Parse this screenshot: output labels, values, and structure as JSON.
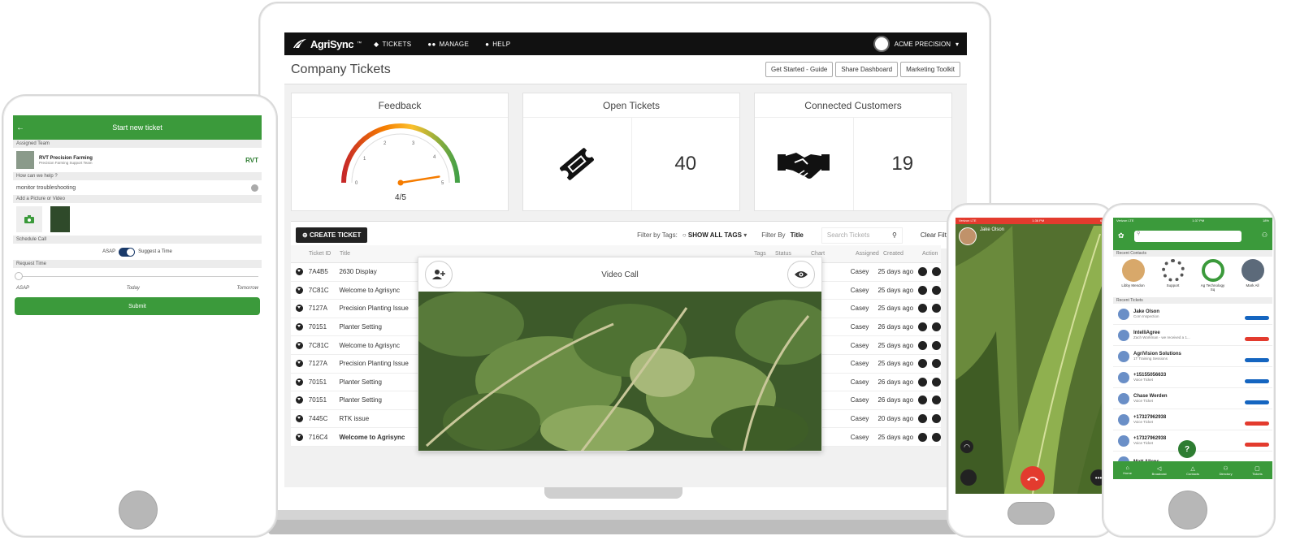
{
  "colors": {
    "green": "#3b9a3b",
    "dark": "#111111",
    "red": "#e33b2e",
    "blue": "#1565c0"
  },
  "laptop": {
    "nav": {
      "brand": "AgriSync",
      "brand_tm": "™",
      "tickets": "TICKETS",
      "manage": "MANAGE",
      "help": "HELP",
      "account": "ACME PRECISION"
    },
    "page_title": "Company Tickets",
    "header_buttons": [
      "Get Started - Guide",
      "Share Dashboard",
      "Marketing Toolkit"
    ],
    "cards": {
      "feedback": {
        "title": "Feedback",
        "value": "4/5",
        "score": 4,
        "max": 5,
        "ticks": [
          "0",
          "1",
          "2",
          "3",
          "4",
          "5"
        ]
      },
      "open": {
        "title": "Open Tickets",
        "value": "40"
      },
      "connected": {
        "title": "Connected Customers",
        "value": "19"
      }
    },
    "toolbar": {
      "create": "CREATE TICKET",
      "filter_tags_label": "Filter by Tags:",
      "show_all": "SHOW ALL TAGS",
      "filter_by_label": "Filter By",
      "filter_by_value": "Title",
      "search_placeholder": "Search Tickets",
      "clear": "Clear Filters"
    },
    "table": {
      "headers": {
        "id": "Ticket ID",
        "title": "Title",
        "tags": "Tags",
        "status": "Status",
        "chart": "Chart",
        "assigned": "Assigned",
        "created": "Created",
        "action": "Action"
      },
      "rows": [
        {
          "id": "7A4B5",
          "title": "2630 Display",
          "assigned": "Casey",
          "created": "25 days ago"
        },
        {
          "id": "7C81C",
          "title": "Welcome to Agrisync",
          "assigned": "Casey",
          "created": "25 days ago"
        },
        {
          "id": "7127A",
          "title": "Precision Planting Issue",
          "assigned": "Casey",
          "created": "25 days ago"
        },
        {
          "id": "70151",
          "title": "Planter Setting",
          "assigned": "Casey",
          "created": "26 days ago"
        },
        {
          "id": "7C81C",
          "title": "Welcome to Agrisync",
          "assigned": "Casey",
          "created": "25 days ago"
        },
        {
          "id": "7127A",
          "title": "Precision Planting Issue",
          "assigned": "Casey",
          "created": "25 days ago"
        },
        {
          "id": "70151",
          "title": "Planter Setting",
          "assigned": "Casey",
          "created": "26 days ago"
        },
        {
          "id": "70151",
          "title": "Planter Setting",
          "assigned": "Casey",
          "created": "26 days ago"
        },
        {
          "id": "7445C",
          "title": "RTK issue",
          "assigned": "Casey",
          "created": "20 days ago"
        },
        {
          "id": "716C4",
          "title": "Welcome to Agrisync",
          "assigned": "Casey",
          "created": "25 days ago"
        }
      ]
    },
    "video_popup": {
      "title": "Video Call"
    }
  },
  "tablet": {
    "header": "Start new ticket",
    "assigned_team_label": "Assigned Team",
    "team_name": "RVT Precision Farming",
    "team_sub": "Precision Farming Support Team",
    "team_logo": "RVT",
    "help_label": "How can we help ?",
    "help_value": "monitor troubleshooting",
    "media_label": "Add a Picture or Video",
    "schedule_label": "Schedule Call",
    "asap": "ASAP",
    "suggest": "Suggest a Time",
    "requested_label": "Request Time",
    "slider_labels": [
      "ASAP",
      "Today",
      "Tomorrow"
    ],
    "slider_value": 0,
    "submit": "Submit"
  },
  "phone1": {
    "carrier": "Verizon  LTE",
    "time": "1:36 PM",
    "battery": "61%",
    "caller": "Jake Olson"
  },
  "phone2": {
    "carrier": "Verizon  LTE",
    "time": "1:37 PM",
    "battery": "18%",
    "recent_contacts_label": "Recent Contacts",
    "contacts": [
      "Libby Mendon",
      "Support",
      "Ag Technology Sq",
      "Mark All"
    ],
    "recent_tickets_label": "Recent Tickets",
    "tickets": [
      {
        "name": "Jake Olson",
        "sub": "Corn Inspection"
      },
      {
        "name": "IntelliAgree",
        "sub": "Zach Workman - we received a 1..."
      },
      {
        "name": "AgriVision Solutions",
        "sub": "1T Training Sessions"
      },
      {
        "name": "+15155056633",
        "sub": "Voice Ticket"
      },
      {
        "name": "Chase Werden",
        "sub": "Voice Ticket"
      },
      {
        "name": "+17327962938",
        "sub": "Voice Ticket"
      },
      {
        "name": "+17327962938",
        "sub": "Voice Ticket"
      },
      {
        "name": "Matt Allens",
        "sub": ""
      }
    ],
    "fab": "?",
    "tabs": [
      "Home",
      "Broadcast",
      "Contacts",
      "Directory",
      "Tickets"
    ]
  }
}
